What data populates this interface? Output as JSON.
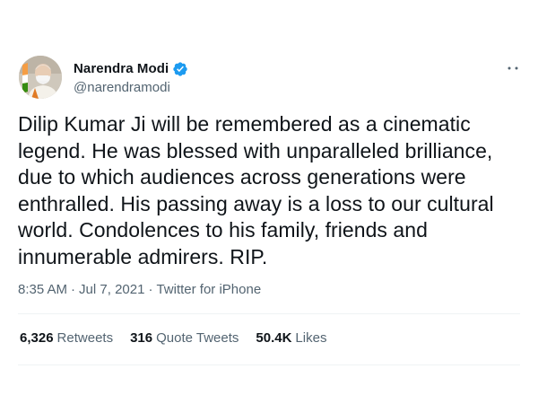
{
  "author": {
    "display_name": "Narendra Modi",
    "handle": "@narendramodi",
    "verified_icon": "verified-badge-icon",
    "avatar_icon": "avatar-photo"
  },
  "menu": {
    "icon": "more-options-icon"
  },
  "tweet": {
    "text": "Dilip Kumar Ji will be remembered as a cinematic\nlegend. He was blessed with unparalleled brilliance,\ndue to which audiences across generations were\nenthralled. His passing away is a loss to our cultural\nworld. Condolences to his family, friends and\ninnumerable admirers. RIP."
  },
  "meta": {
    "time": "8:35 AM",
    "separator": "·",
    "date": "Jul 7, 2021",
    "source": "Twitter for iPhone"
  },
  "stats": {
    "retweets_count": "6,326",
    "retweets_label": "Retweets",
    "quotes_count": "316",
    "quotes_label": "Quote Tweets",
    "likes_count": "50.4K",
    "likes_label": "Likes"
  },
  "colors": {
    "text_primary": "#0f1419",
    "text_secondary": "#536471",
    "verified_blue": "#1d9bf0",
    "divider": "#eff3f4"
  }
}
